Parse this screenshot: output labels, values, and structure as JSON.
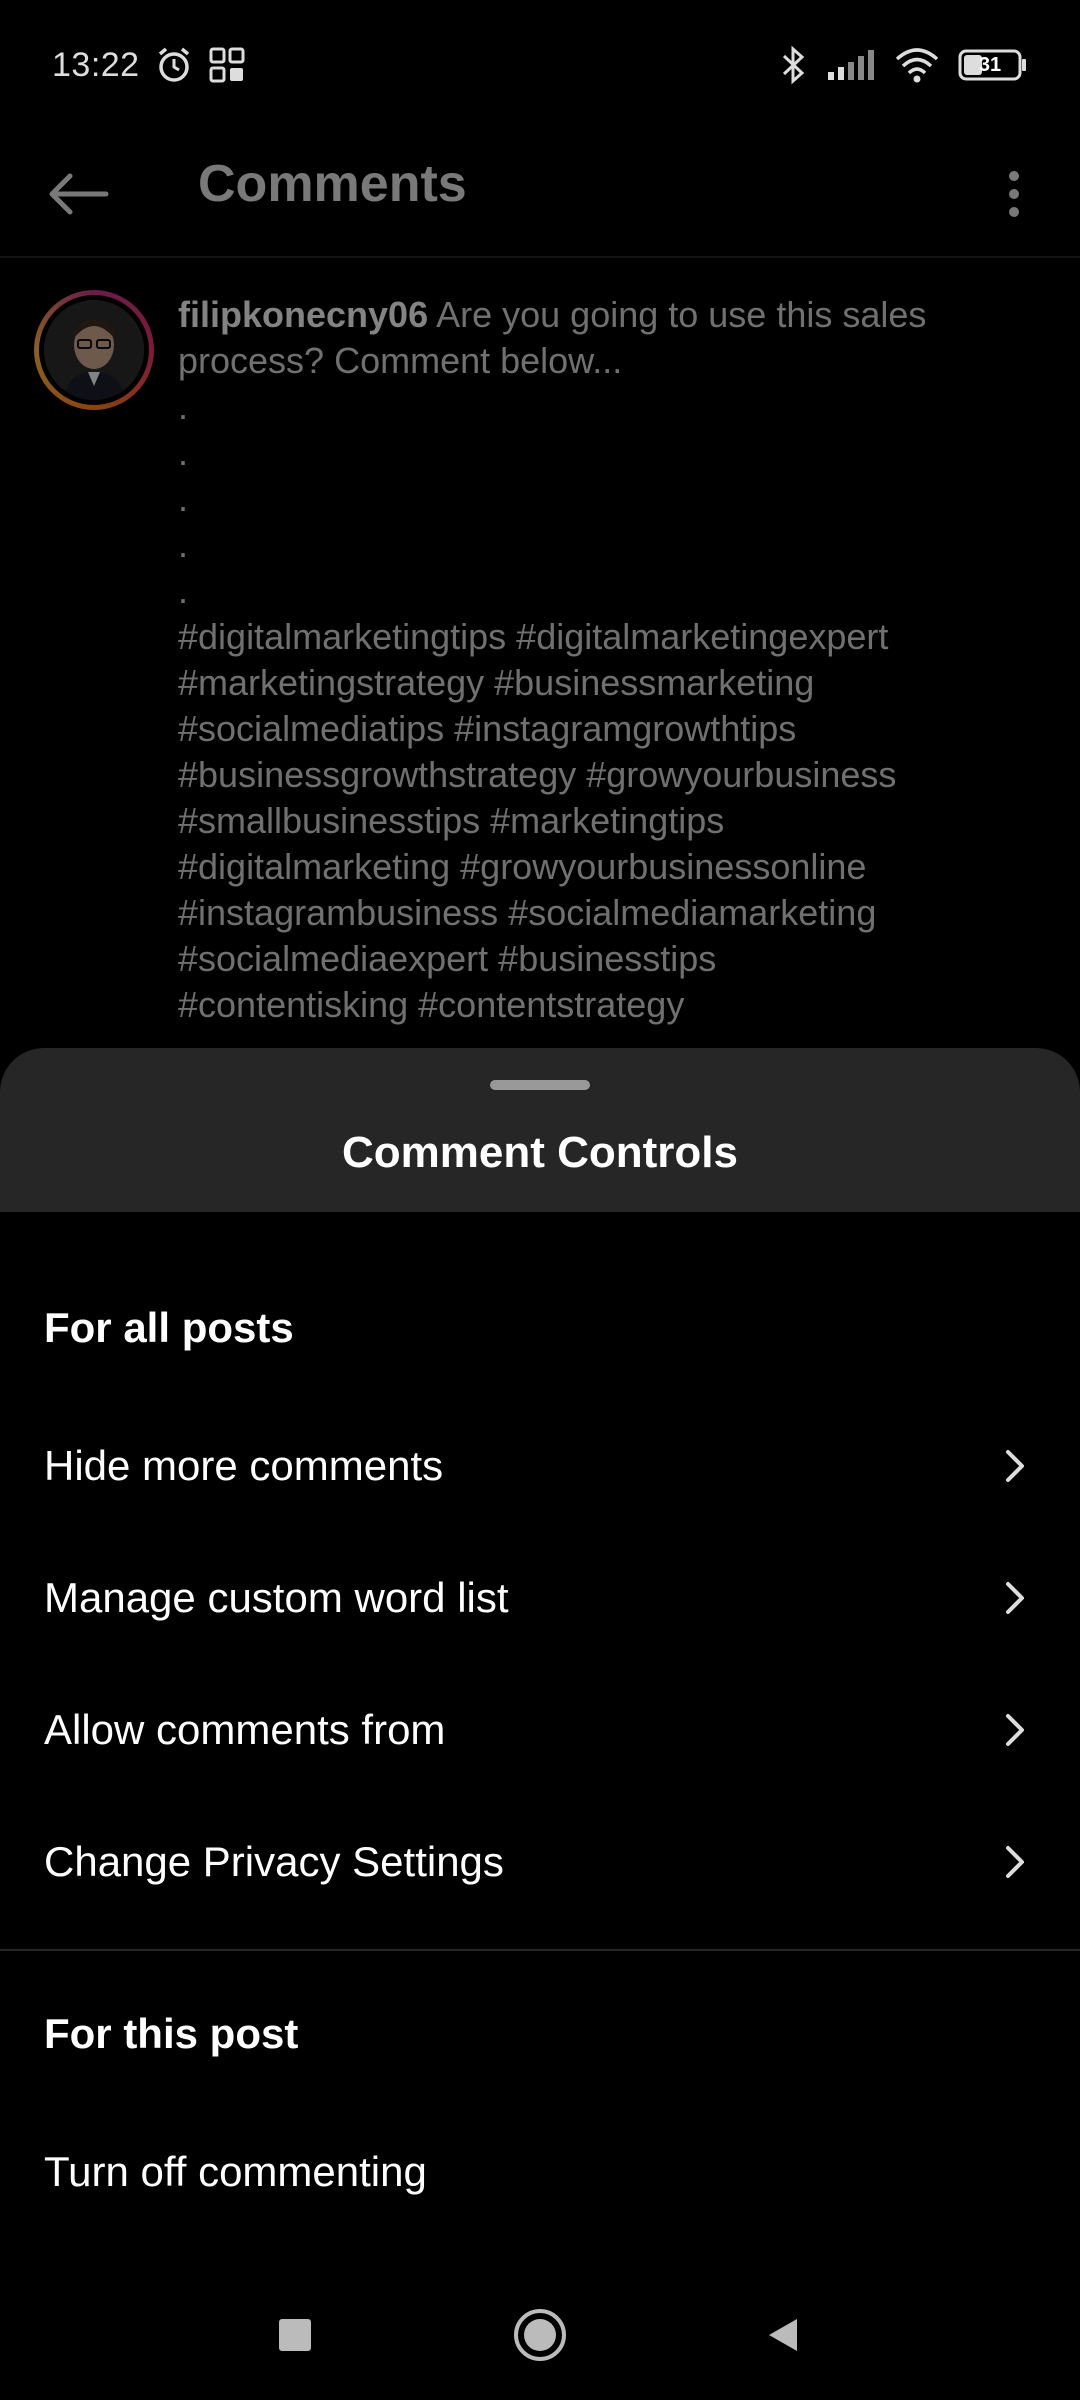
{
  "status_bar": {
    "time": "13:22",
    "battery": "31",
    "icons": [
      "alarm-icon",
      "grid-icon",
      "bluetooth-icon",
      "signal-icon",
      "wifi-icon",
      "battery-icon"
    ]
  },
  "header": {
    "title": "Comments",
    "back_icon": "back-arrow-icon",
    "more_icon": "more-vertical-icon"
  },
  "caption": {
    "username": "filipkonecny06",
    "text": "Are you going to use this sales process? Comment below...",
    "dots": [
      ".",
      ".",
      ".",
      ".",
      "."
    ],
    "hashtags": [
      "#digitalmarketingtips #digitalmarketingexpert",
      "#marketingstrategy #businessmarketing",
      "#socialmediatips #instagramgrowthtips",
      "#businessgrowthstrategy #growyourbusiness",
      "#smallbusinesstips #marketingtips",
      "#digitalmarketing #growyourbusinessonline",
      "#instagrambusiness #socialmediamarketing",
      "#socialmediaexpert #businesstips",
      "#contentisking #contentstrategy"
    ]
  },
  "sheet": {
    "title": "Comment Controls",
    "sections": [
      {
        "title": "For all posts",
        "items": [
          {
            "label": "Hide more comments",
            "has_chevron": true
          },
          {
            "label": "Manage custom word list",
            "has_chevron": true
          },
          {
            "label": "Allow comments from",
            "has_chevron": true
          },
          {
            "label": "Change Privacy Settings",
            "has_chevron": true
          }
        ]
      },
      {
        "title": "For this post",
        "items": [
          {
            "label": "Turn off commenting",
            "has_chevron": false
          }
        ]
      }
    ]
  },
  "nav_bar": {
    "icons": [
      "recents-square-icon",
      "home-circle-icon",
      "back-triangle-icon"
    ]
  },
  "colors": {
    "background": "#000000",
    "sheet_header": "#262626",
    "text": "#ffffff"
  }
}
